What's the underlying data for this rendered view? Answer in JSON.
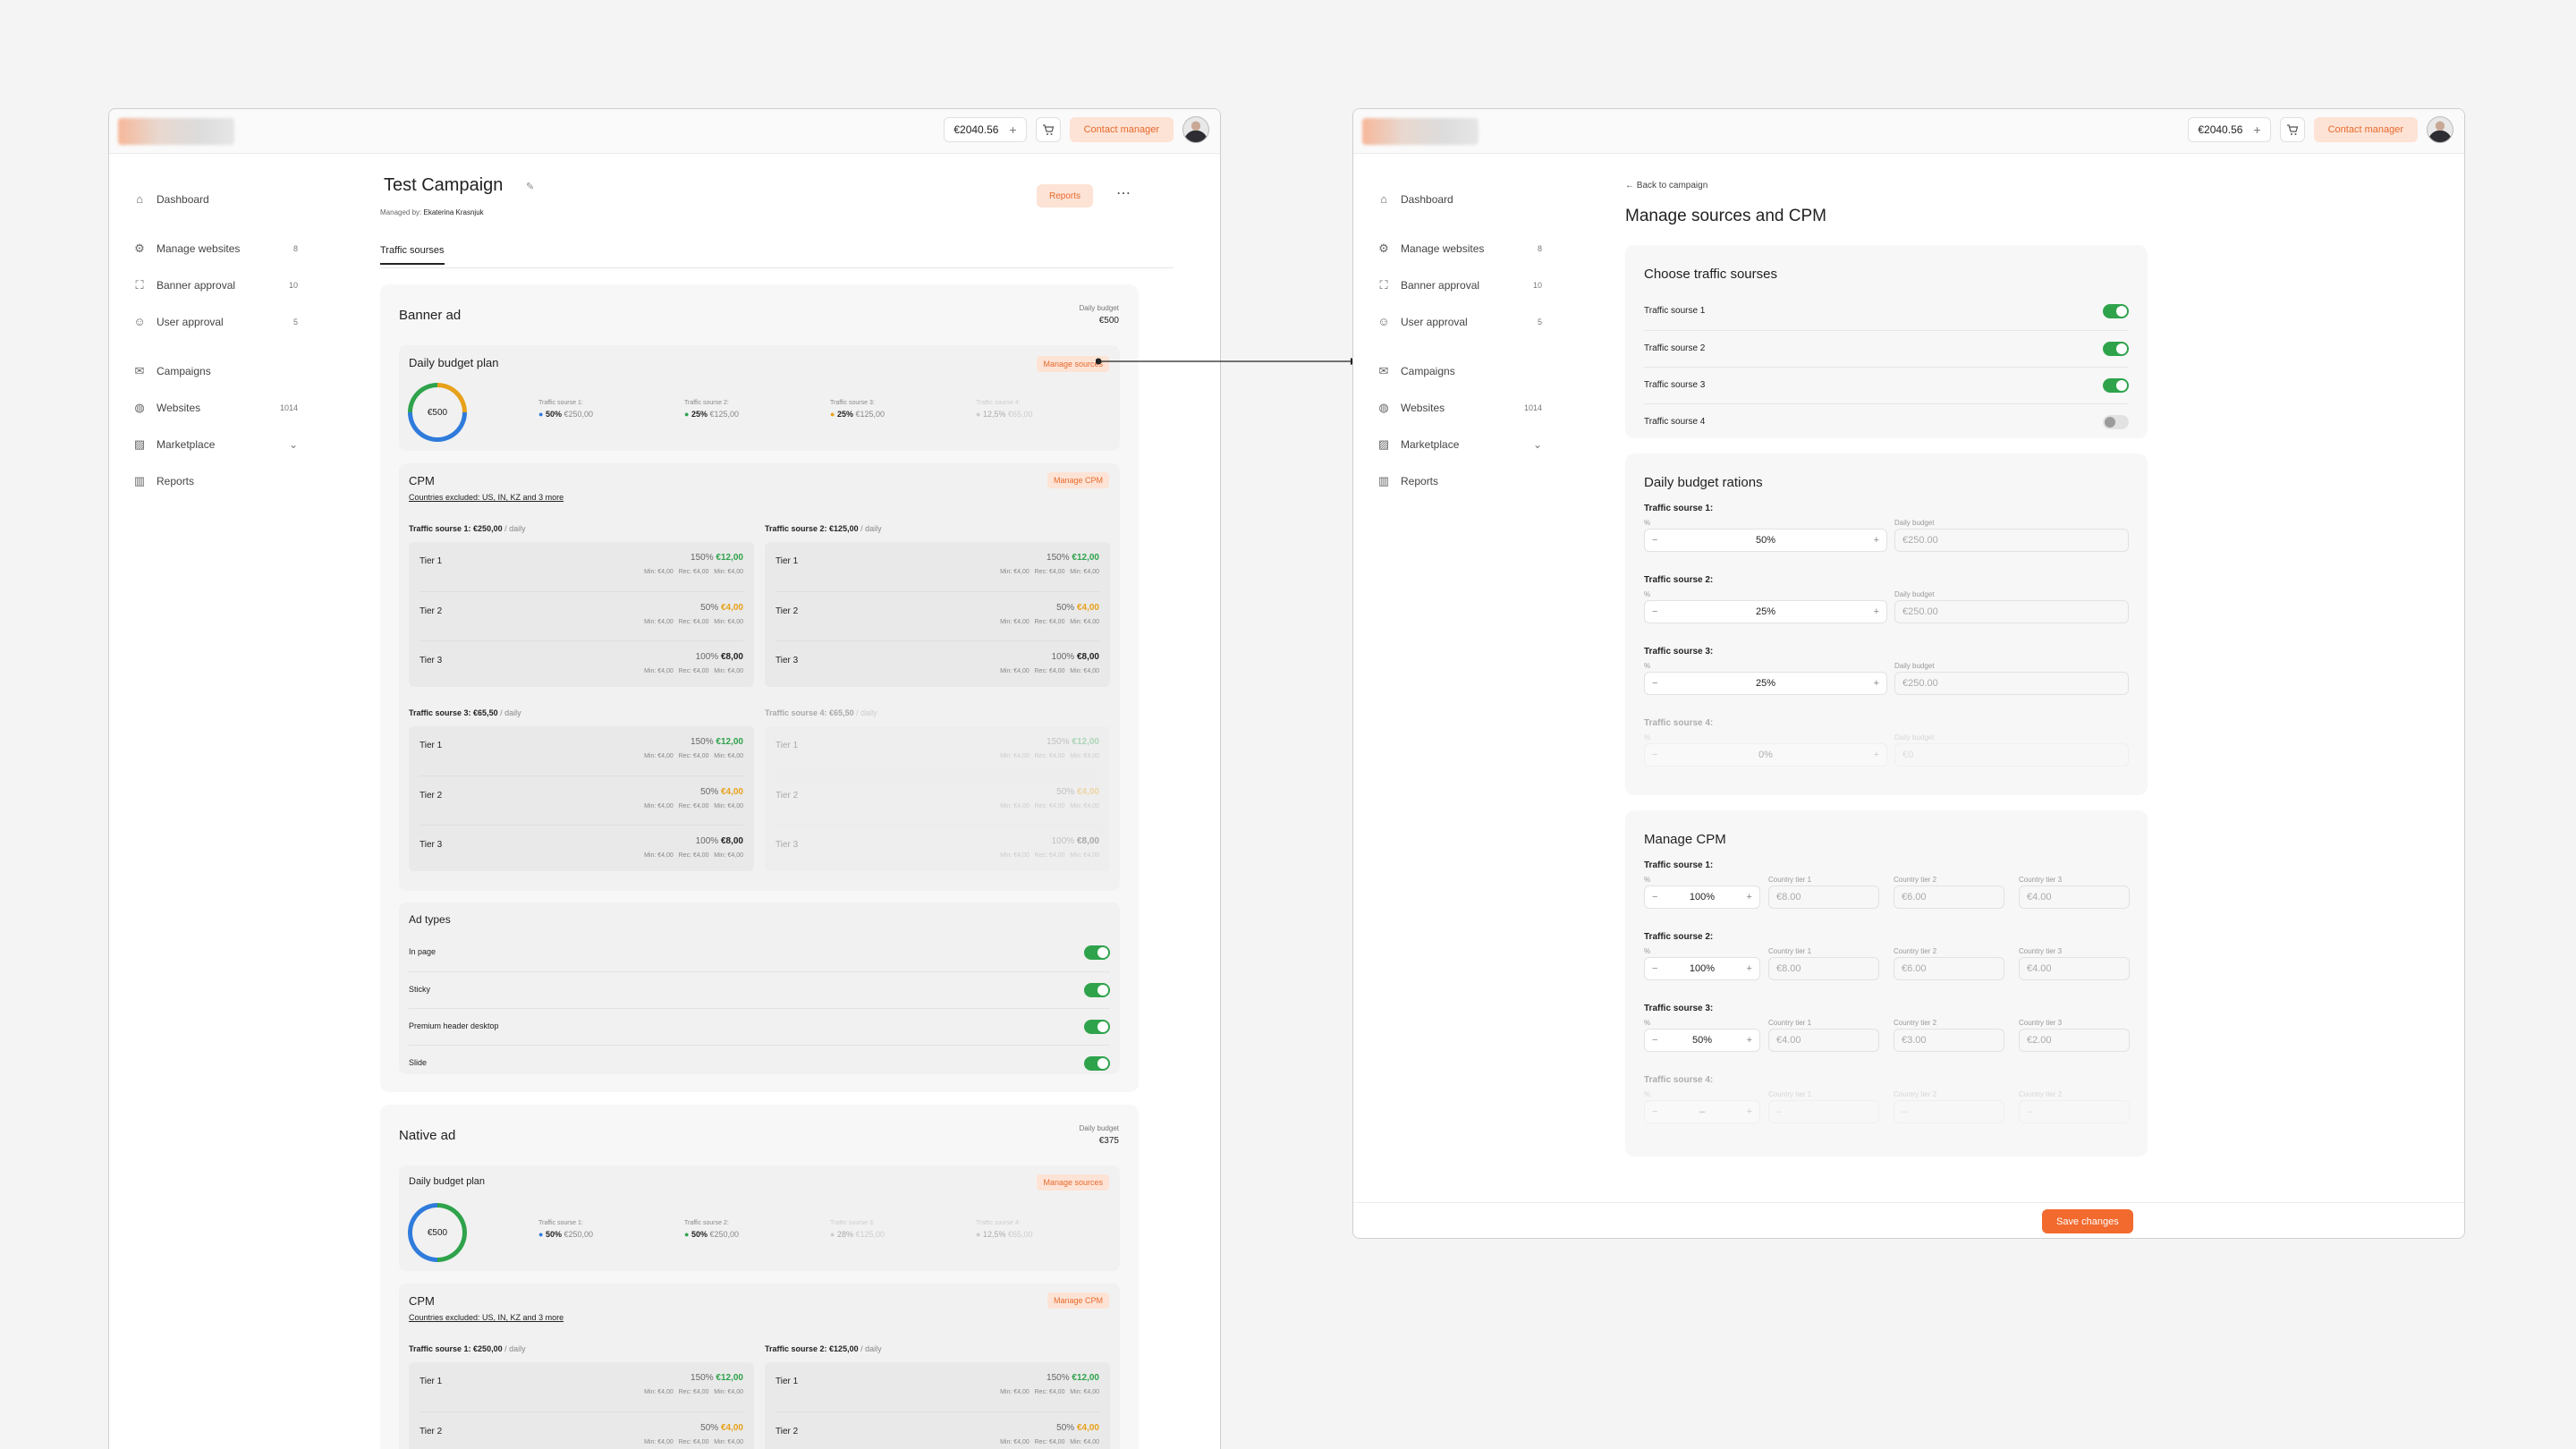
{
  "topbar": {
    "balance": "€2040.56",
    "contact": "Contact manager"
  },
  "nav": {
    "dashboard": "Dashboard",
    "manage_websites": "Manage websites",
    "manage_websites_count": "8",
    "banner_approval": "Banner approval",
    "banner_approval_count": "10",
    "user_approval": "User approval",
    "user_approval_count": "5",
    "campaigns": "Campaigns",
    "websites": "Websites",
    "websites_count": "1014",
    "marketplace": "Marketplace",
    "reports": "Reports"
  },
  "campaign": {
    "title": "Test Campaign",
    "managed_label": "Managed by:",
    "managed_by": "Ekaterina Krasnjuk",
    "reports": "Reports",
    "tab": "Traffic sourses"
  },
  "banner": {
    "title": "Banner ad",
    "budget_label": "Daily budget",
    "budget": "€500",
    "plan_title": "Daily budget plan",
    "manage_sources": "Manage sources",
    "donut": "€500",
    "sources": [
      {
        "label": "Traffic sourse 1:",
        "pct": "50%",
        "amt": "€250,00"
      },
      {
        "label": "Traffic sourse 2:",
        "pct": "25%",
        "amt": "€125,00"
      },
      {
        "label": "Traffic sourse 3:",
        "pct": "25%",
        "amt": "€125,00"
      },
      {
        "label": "Traffic sourse 4:",
        "pct": "12,5%",
        "amt": "€65,00"
      }
    ],
    "cpm_title": "CPM",
    "countries": "Countries excluded: US, IN, KZ and 3 more",
    "manage_cpm": "Manage CPM",
    "groups": [
      {
        "name": "Traffic sourse 1:",
        "amt": "€250,00",
        "per": "/ daily"
      },
      {
        "name": "Traffic sourse 2:",
        "amt": "€125,00",
        "per": "/ daily"
      },
      {
        "name": "Traffic sourse 3:",
        "amt": "€65,50",
        "per": "/ daily"
      },
      {
        "name": "Traffic sourse 4:",
        "amt": "€65,50",
        "per": "/ daily"
      }
    ],
    "tiers": [
      {
        "name": "Tier 1",
        "pct": "150%",
        "val": "€12,00"
      },
      {
        "name": "Tier 2",
        "pct": "50%",
        "val": "€4,00"
      },
      {
        "name": "Tier 3",
        "pct": "100%",
        "val": "€8,00"
      }
    ],
    "minline": "Min: €4,00   Rec: €4,00   Min: €4,00",
    "ad_types_title": "Ad types",
    "ad_types": [
      "In page",
      "Sticky",
      "Premium header desktop",
      "Slide"
    ]
  },
  "native": {
    "title": "Native ad",
    "budget_label": "Daily budget",
    "budget": "€375",
    "plan_title": "Daily budget plan",
    "manage_sources": "Manage sources",
    "donut": "€500",
    "sources": [
      {
        "label": "Traffic sourse 1:",
        "pct": "50%",
        "amt": "€250,00"
      },
      {
        "label": "Traffic sourse 2:",
        "pct": "50%",
        "amt": "€250,00"
      },
      {
        "label": "Traffic sourse 3:",
        "pct": "28%",
        "amt": "€125,00"
      },
      {
        "label": "Traffic sourse 4:",
        "pct": "12,5%",
        "amt": "€65,00"
      }
    ],
    "cpm_title": "CPM",
    "countries": "Countries excluded: US, IN, KZ and 3 more",
    "manage_cpm": "Manage CPM",
    "groups": [
      {
        "name": "Traffic sourse 1:",
        "amt": "€250,00",
        "per": "/ daily"
      },
      {
        "name": "Traffic sourse 2:",
        "amt": "€125,00",
        "per": "/ daily"
      }
    ]
  },
  "manage": {
    "back": "Back to campaign",
    "title": "Manage sources and CPM",
    "choose_title": "Choose traffic sourses",
    "choose": [
      "Traffic sourse 1",
      "Traffic sourse 2",
      "Traffic sourse 3",
      "Traffic sourse 4"
    ],
    "rations_title": "Daily budget rations",
    "pct_label": "%",
    "daily_label": "Daily budget",
    "rations": [
      {
        "label": "Traffic sourse 1:",
        "pct": "50%",
        "budget": "€250.00"
      },
      {
        "label": "Traffic sourse 2:",
        "pct": "25%",
        "budget": "€250.00"
      },
      {
        "label": "Traffic sourse 3:",
        "pct": "25%",
        "budget": "€250.00"
      },
      {
        "label": "Traffic sourse 4:",
        "pct": "0%",
        "budget": "€0"
      }
    ],
    "cpm_title": "Manage CPM",
    "t1": "Country tier 1",
    "t2": "Country tier 2",
    "t3": "Country tier 3",
    "cpm": [
      {
        "label": "Traffic sourse 1:",
        "pct": "100%",
        "a": "€8.00",
        "b": "€6.00",
        "c": "€4.00"
      },
      {
        "label": "Traffic sourse 2:",
        "pct": "100%",
        "a": "€8.00",
        "b": "€6.00",
        "c": "€4.00"
      },
      {
        "label": "Traffic sourse 3:",
        "pct": "50%",
        "a": "€4.00",
        "b": "€3.00",
        "c": "€2.00"
      },
      {
        "label": "Traffic sourse 4:",
        "pct": "–",
        "a": "–",
        "b": "–",
        "c": "–"
      }
    ],
    "save": "Save changes"
  },
  "colors": {
    "accent": "#f26a2e",
    "green": "#2fa34c",
    "blue": "#2f7bdc",
    "orange": "#e7a11a"
  }
}
